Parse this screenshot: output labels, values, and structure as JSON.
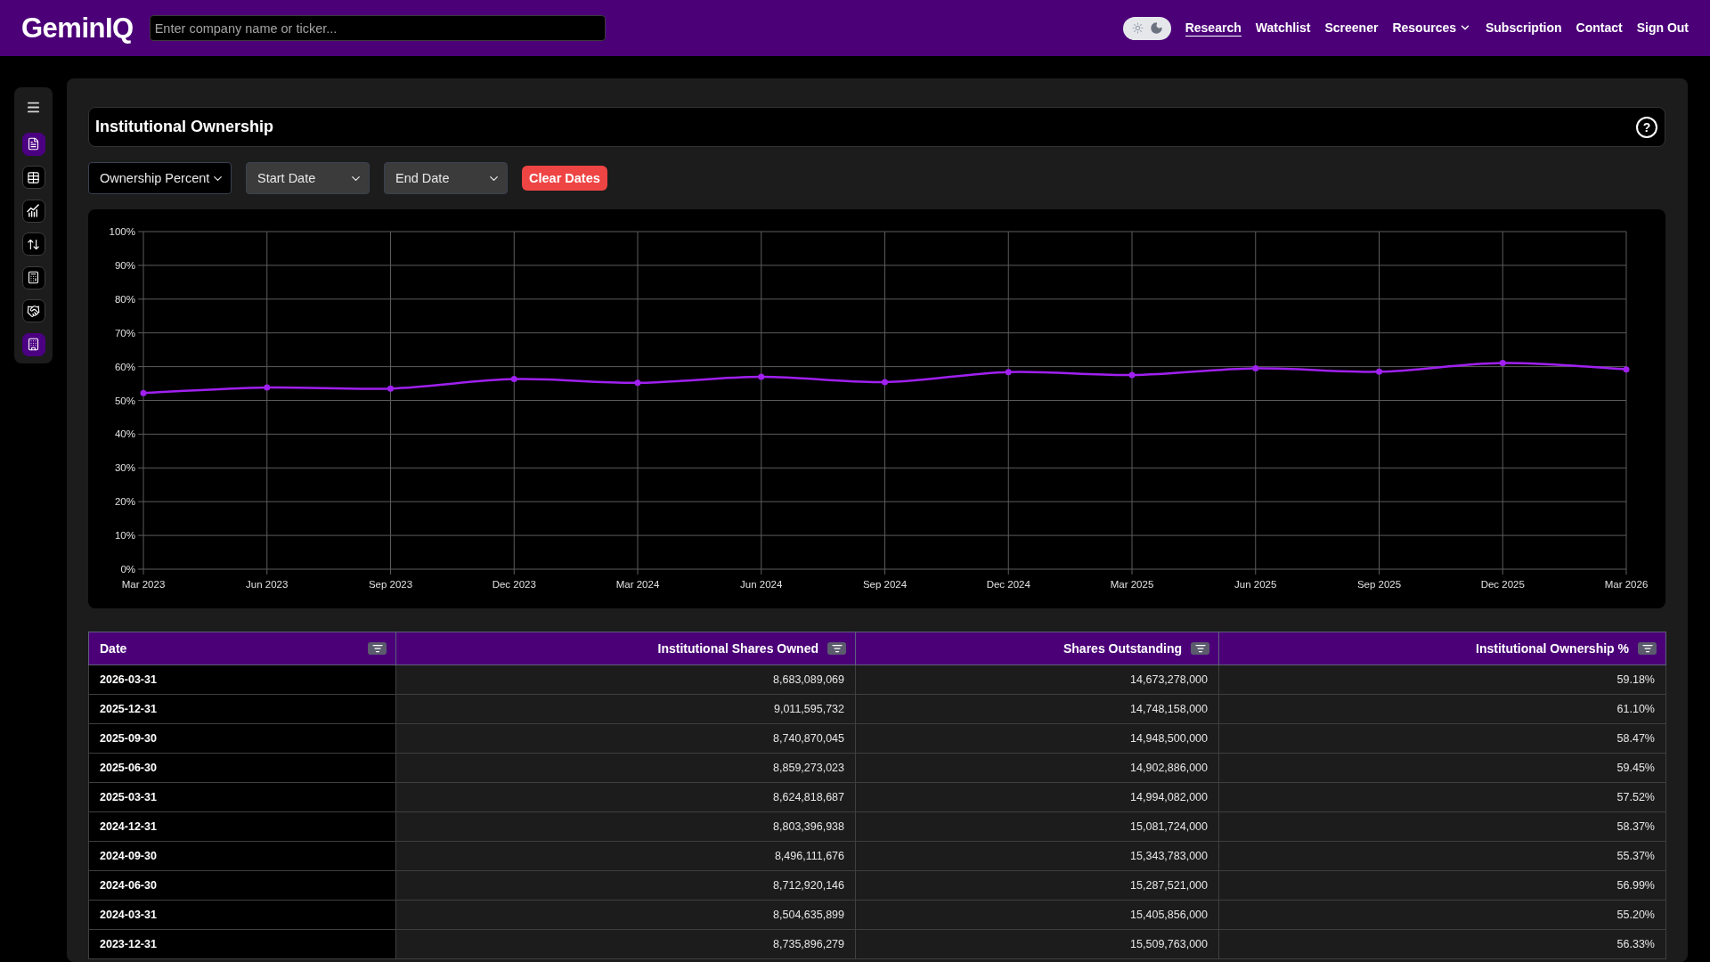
{
  "top_bar": {
    "logo": "GeminIQ",
    "search": {
      "placeholder": "Enter company name or ticker..."
    },
    "theme_toggle": {
      "dark": true
    },
    "nav": [
      {
        "label": "Research",
        "kind": "link",
        "selected": true
      },
      {
        "label": "Watchlist",
        "kind": "link",
        "selected": false
      },
      {
        "label": "Screener",
        "kind": "link",
        "selected": false
      },
      {
        "label": "Resources",
        "kind": "menu",
        "selected": false
      },
      {
        "label": "Subscription",
        "kind": "link",
        "selected": false
      },
      {
        "label": "Contact",
        "kind": "link",
        "selected": false
      },
      {
        "label": "Sign Out",
        "kind": "link",
        "selected": false
      }
    ]
  },
  "sidebar": {
    "items": [
      {
        "selected": true
      },
      {
        "selected": false
      },
      {
        "selected": false
      },
      {
        "selected": false
      },
      {
        "selected": false
      },
      {
        "selected": false
      },
      {
        "selected": true
      }
    ]
  },
  "panel": {
    "title": "Institutional Ownership",
    "help": "?",
    "filters": [
      {
        "value": "Ownership Percent"
      },
      {
        "placeholder": "Start Date"
      },
      {
        "placeholder": "End Date"
      }
    ],
    "clear_button": {
      "label": "Clear Dates"
    },
    "chart": {
      "chart_data": {
        "type": "line",
        "grid": true,
        "categories": [
          "Mar 2023",
          "Jun 2023",
          "Sep 2023",
          "Dec 2023",
          "Mar 2024",
          "Jun 2024",
          "Sep 2024",
          "Dec 2024",
          "Mar 2025",
          "Jun 2025",
          "Sep 2025",
          "Dec 2025",
          "Mar 2026"
        ],
        "series": [
          {
            "color": "#a020f0",
            "marker": "circle",
            "values": [
              52.2,
              53.8,
              53.5,
              56.3,
              55.2,
              57.0,
              55.4,
              58.4,
              57.5,
              59.5,
              58.5,
              61.1,
              59.2
            ]
          }
        ],
        "ylim": [
          0,
          100
        ],
        "yticks": [
          {
            "value": 0,
            "label": "0%"
          },
          {
            "value": 10,
            "label": "10%"
          },
          {
            "value": 20,
            "label": "20%"
          },
          {
            "value": 30,
            "label": "30%"
          },
          {
            "value": 40,
            "label": "40%"
          },
          {
            "value": 50,
            "label": "50%"
          },
          {
            "value": 60,
            "label": "60%"
          },
          {
            "value": 70,
            "label": "70%"
          },
          {
            "value": 80,
            "label": "80%"
          },
          {
            "value": 90,
            "label": "90%"
          },
          {
            "value": 100,
            "label": "100%"
          }
        ]
      }
    },
    "table": {
      "columns": [
        {
          "label": "Date",
          "kind": "date"
        },
        {
          "label": "Institutional Shares Owned",
          "kind": "number"
        },
        {
          "label": "Shares Outstanding",
          "kind": "number"
        },
        {
          "label": "Institutional Ownership %",
          "kind": "number"
        }
      ],
      "rows": [
        [
          "2026-03-31",
          "8,683,089,069",
          "14,673,278,000",
          "59.18%"
        ],
        [
          "2025-12-31",
          "9,011,595,732",
          "14,748,158,000",
          "61.10%"
        ],
        [
          "2025-09-30",
          "8,740,870,045",
          "14,948,500,000",
          "58.47%"
        ],
        [
          "2025-06-30",
          "8,859,273,023",
          "14,902,886,000",
          "59.45%"
        ],
        [
          "2025-03-31",
          "8,624,818,687",
          "14,994,082,000",
          "57.52%"
        ],
        [
          "2024-12-31",
          "8,803,396,938",
          "15,081,724,000",
          "58.37%"
        ],
        [
          "2024-09-30",
          "8,496,111,676",
          "15,343,783,000",
          "55.37%"
        ],
        [
          "2024-06-30",
          "8,712,920,146",
          "15,287,521,000",
          "56.99%"
        ],
        [
          "2024-03-31",
          "8,504,635,899",
          "15,405,856,000",
          "55.20%"
        ],
        [
          "2023-12-31",
          "8,735,896,279",
          "15,509,763,000",
          "56.33%"
        ]
      ]
    }
  }
}
